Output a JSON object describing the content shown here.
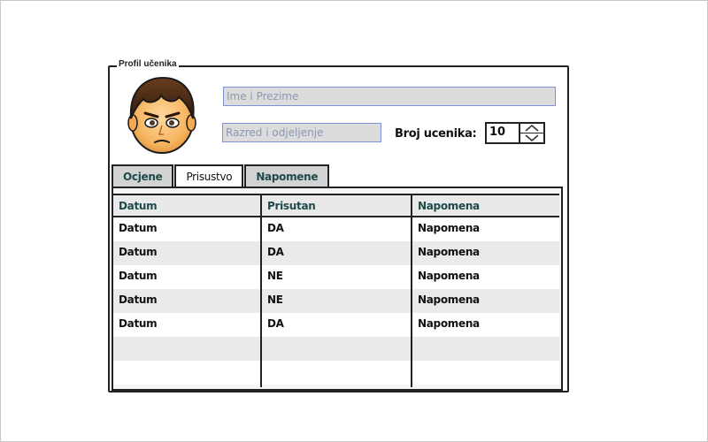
{
  "profile": {
    "legend": "Profil učenika",
    "name_placeholder": "Ime i Prezime",
    "grade_placeholder": "Razred i odjeljenje",
    "count_label": "Broj ucenika:",
    "count_value": "10"
  },
  "tabs": [
    {
      "label": "Ocjene",
      "active": false
    },
    {
      "label": "Prisustvo",
      "active": true
    },
    {
      "label": "Napomene",
      "active": false
    }
  ],
  "table": {
    "headers": [
      "Datum",
      "Prisutan",
      "Napomena"
    ],
    "rows": [
      [
        "Datum",
        "DA",
        "Napomena"
      ],
      [
        "Datum",
        "DA",
        "Napomena"
      ],
      [
        "Datum",
        "NE",
        "Napomena"
      ],
      [
        "Datum",
        "NE",
        "Napomena"
      ],
      [
        "Datum",
        "DA",
        "Napomena"
      ],
      [
        "",
        "",
        ""
      ],
      [
        "",
        "",
        ""
      ]
    ]
  },
  "colors": {
    "tab_text": "#1f4a4a",
    "input_bg": "#dcdcdc",
    "input_border": "#7b93d4"
  },
  "icons": [
    "avatar-face-icon",
    "stepper-up-icon",
    "stepper-down-icon"
  ]
}
